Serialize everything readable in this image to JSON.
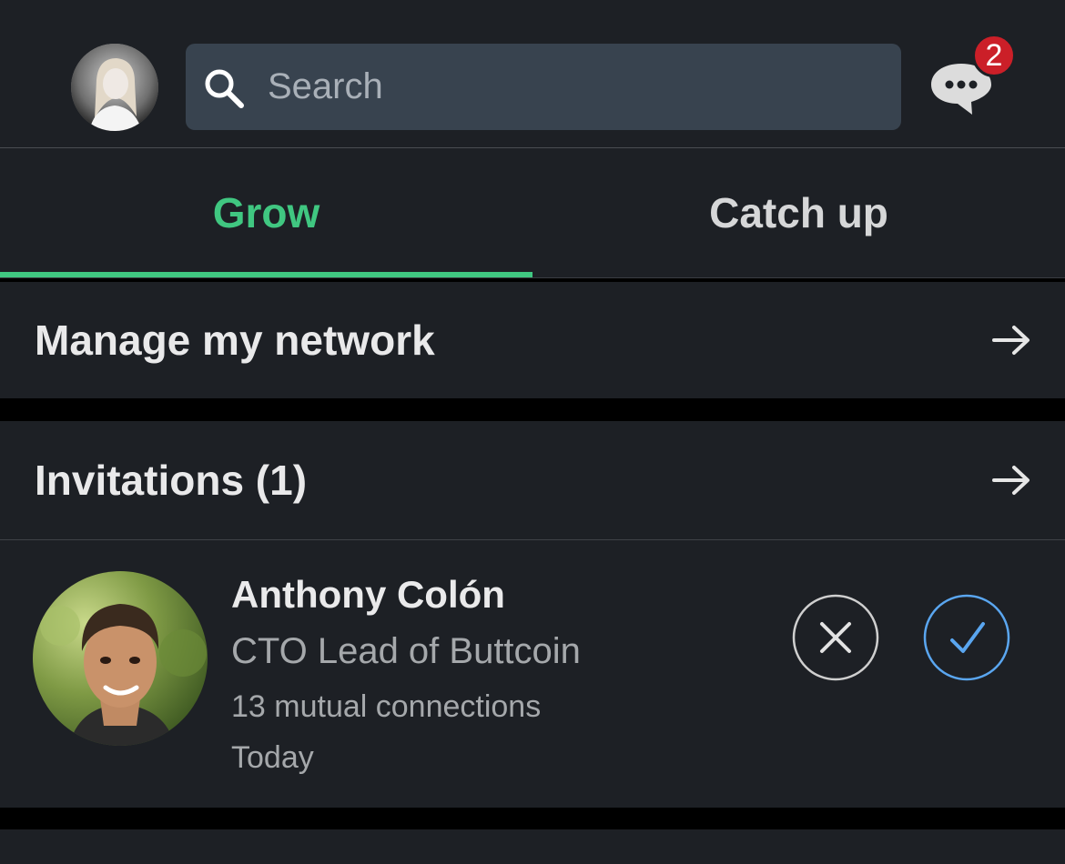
{
  "header": {
    "search_placeholder": "Search",
    "message_badge_count": "2",
    "icons": {
      "search": "search-icon",
      "messages": "message-bubble-icon"
    }
  },
  "tabs": [
    {
      "label": "Grow",
      "selected": true
    },
    {
      "label": "Catch up",
      "selected": false
    }
  ],
  "manage": {
    "label": "Manage my network"
  },
  "invitations": {
    "title": "Invitations (1)",
    "items": [
      {
        "name": "Anthony Colón",
        "headline": "CTO Lead of Buttcoin",
        "mutual": "13 mutual connections",
        "time": "Today"
      }
    ]
  },
  "colors": {
    "accent_green": "#40c781",
    "accept_blue": "#5aa6f0",
    "badge_red": "#cb1f28",
    "card_bg": "#1d2025"
  }
}
